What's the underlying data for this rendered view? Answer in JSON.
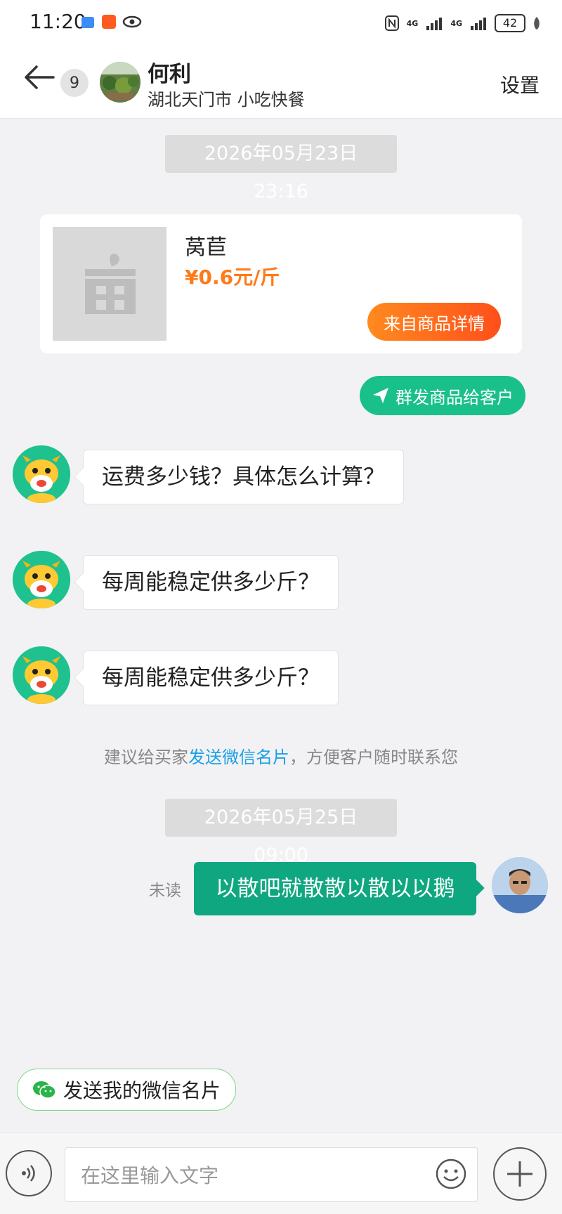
{
  "status_bar": {
    "time": "11:20",
    "battery": "42",
    "network_1": "4G",
    "network_2": "4G"
  },
  "header": {
    "back_icon": "arrow-left-icon",
    "unread_count": "9",
    "name": "何利",
    "subtitle": "湖北天门市 小吃快餐",
    "settings_label": "设置"
  },
  "messages": {
    "timestamp_1": "2026年05月23日 23:16",
    "product": {
      "name": "莴苣",
      "price": "¥0.6元/斤",
      "source_button": "来自商品详情"
    },
    "broadcast_button": "群发商品给客户",
    "incoming": [
      "运费多少钱？具体怎么计算？",
      "每周能稳定供多少斤？",
      "每周能稳定供多少斤？"
    ],
    "hint_prefix": "建议给买家",
    "hint_link": "发送微信名片",
    "hint_suffix": "，方便客户随时联系您",
    "timestamp_2": "2026年05月25日 09:00",
    "outgoing_status": "未读",
    "outgoing_text": "以散吧就散散以散以以鹅"
  },
  "wechat_card_button": "发送我的微信名片",
  "input": {
    "placeholder": "在这里输入文字"
  },
  "colors": {
    "accent_green": "#19c089",
    "price_orange": "#ff7a1a",
    "link_blue": "#1aa0e6"
  }
}
